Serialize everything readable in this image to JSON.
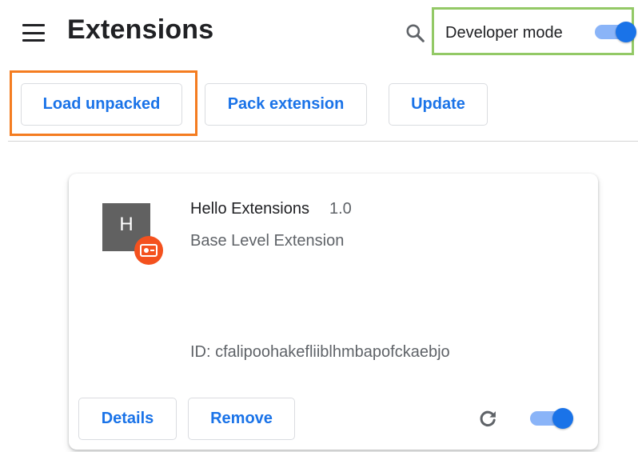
{
  "header": {
    "title": "Extensions",
    "menu_icon": "hamburger-menu-icon",
    "search_icon": "search-icon",
    "developer_mode": {
      "label": "Developer mode",
      "enabled": true,
      "highlight_color": "#93c966"
    }
  },
  "toolbar": {
    "load_unpacked_label": "Load unpacked",
    "pack_extension_label": "Pack extension",
    "update_label": "Update",
    "load_highlight_color": "#f47c20"
  },
  "extension": {
    "icon_letter": "H",
    "badge_icon": "devmode-badge-icon",
    "name": "Hello Extensions",
    "version": "1.0",
    "description": "Base Level Extension",
    "id_text": "ID: cfalipoohakefliiblhmbapofckaebjo",
    "details_label": "Details",
    "remove_label": "Remove",
    "reload_icon": "reload-icon",
    "enabled": true
  },
  "colors": {
    "accent": "#1a73e8",
    "toggle_track": "#8ab4f8",
    "badge": "#f4511e",
    "icon_bg": "#616161"
  }
}
